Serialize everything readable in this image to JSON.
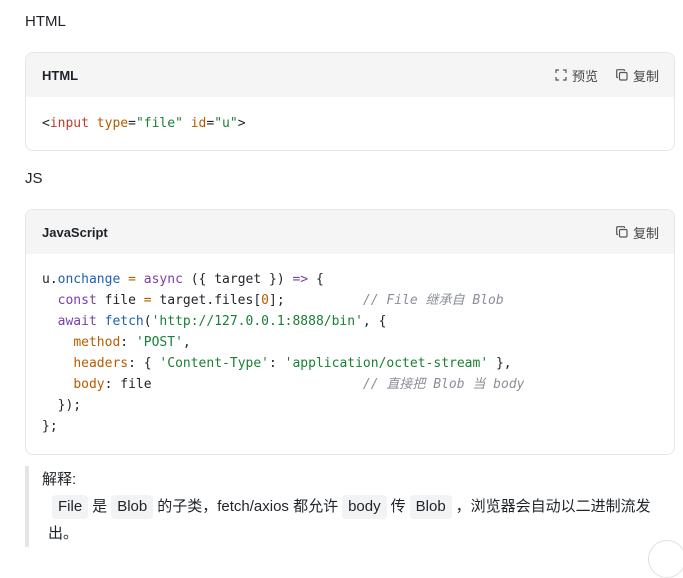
{
  "sections": {
    "html_heading": "HTML",
    "js_heading": "JS"
  },
  "html_card": {
    "lang": "HTML",
    "preview_label": "预览",
    "copy_label": "复制",
    "code": {
      "open": "<",
      "tag": "input",
      "attr1": "type",
      "eq1": "=",
      "val1": "\"file\"",
      "attr2": "id",
      "eq2": "=",
      "val2": "\"u\"",
      "close": ">"
    }
  },
  "js_card": {
    "lang": "JavaScript",
    "copy_label": "复制",
    "lines": {
      "l1": {
        "a": "u.",
        "b": "onchange",
        "c": " = ",
        "d": "async",
        "e": " ({ target }) ",
        "f": "=>",
        "g": " {"
      },
      "l2": {
        "a": "  ",
        "b": "const",
        "c": " file ",
        "d": "=",
        "e": " target.files[",
        "f": "0",
        "g": "];",
        "h": "          // File 继承自 Blob"
      },
      "l3": {
        "a": "  ",
        "b": "await",
        "c": " ",
        "d": "fetch",
        "e": "(",
        "f": "'http://127.0.0.1:8888/bin'",
        "g": ", {"
      },
      "l4": {
        "a": "    ",
        "b": "method",
        "c": ": ",
        "d": "'POST'",
        "e": ","
      },
      "l5": {
        "a": "    ",
        "b": "headers",
        "c": ": { ",
        "d": "'Content-Type'",
        "e": ": ",
        "f": "'application/octet-stream'",
        "g": " },"
      },
      "l6": {
        "a": "    ",
        "b": "body",
        "c": ": file",
        "d": "                           // 直接把 Blob 当 body"
      },
      "l7": {
        "a": "  });"
      },
      "l8": {
        "a": "};"
      }
    }
  },
  "explanation": {
    "title": "解释:",
    "chip1": "File",
    "t1": "是",
    "chip2": "Blob",
    "t2": "的子类，fetch/axios 都允许",
    "chip3": "body",
    "t3": "传",
    "chip4": "Blob",
    "t4": "，浏览器会自动以二进制流发出。"
  },
  "icons": {
    "preview": "expand-icon",
    "copy": "copy-icon"
  }
}
